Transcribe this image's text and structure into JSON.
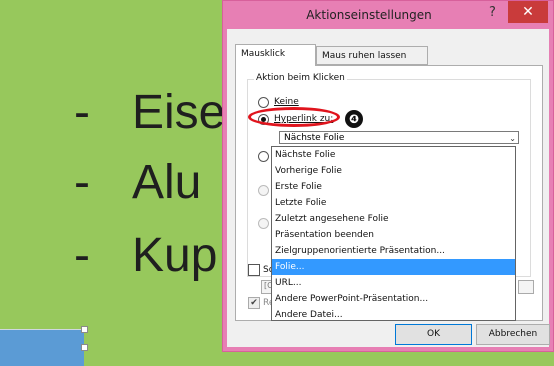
{
  "slide": {
    "bullets": [
      {
        "dash": "-",
        "text": "Eise"
      },
      {
        "dash": "-",
        "text": "Alu"
      },
      {
        "dash": "-",
        "text": "Kup"
      }
    ]
  },
  "dialog": {
    "title": "Aktionseinstellungen",
    "help": "?",
    "close": "✕",
    "tabs": [
      "Mausklick",
      "Maus ruhen lassen auf"
    ],
    "group_label": "Aktion beim Klicken",
    "option_none": "Keine",
    "option_hyperlink": "Hyperlink zu:",
    "hyperlink_selected": "Nächste Folie",
    "dropdown_arrow": "⌄",
    "dropdown_items": [
      "Nächste Folie",
      "Vorherige Folie",
      "Erste Folie",
      "Letzte Folie",
      "Zuletzt angesehene Folie",
      "Präsentation beenden",
      "Zielgruppenorientierte Präsentation...",
      "Folie...",
      "URL...",
      "Andere PowerPoint-Präsentation...",
      "Andere Datei..."
    ],
    "highlighted_item": "Folie...",
    "sound_label_partial": "So",
    "sound_field_partial": "[C",
    "highlight_label_partial": "Re",
    "check_mark": "✔",
    "ok_label": "OK",
    "cancel_label": "Abbrechen"
  },
  "annotation": {
    "step_number": "❹",
    "accent_color": "#e0141d"
  },
  "colors": {
    "slide_background": "#97c85c",
    "titlebar": "#e77fb4",
    "close_button": "#c93b3b",
    "selection": "#3399ff"
  }
}
